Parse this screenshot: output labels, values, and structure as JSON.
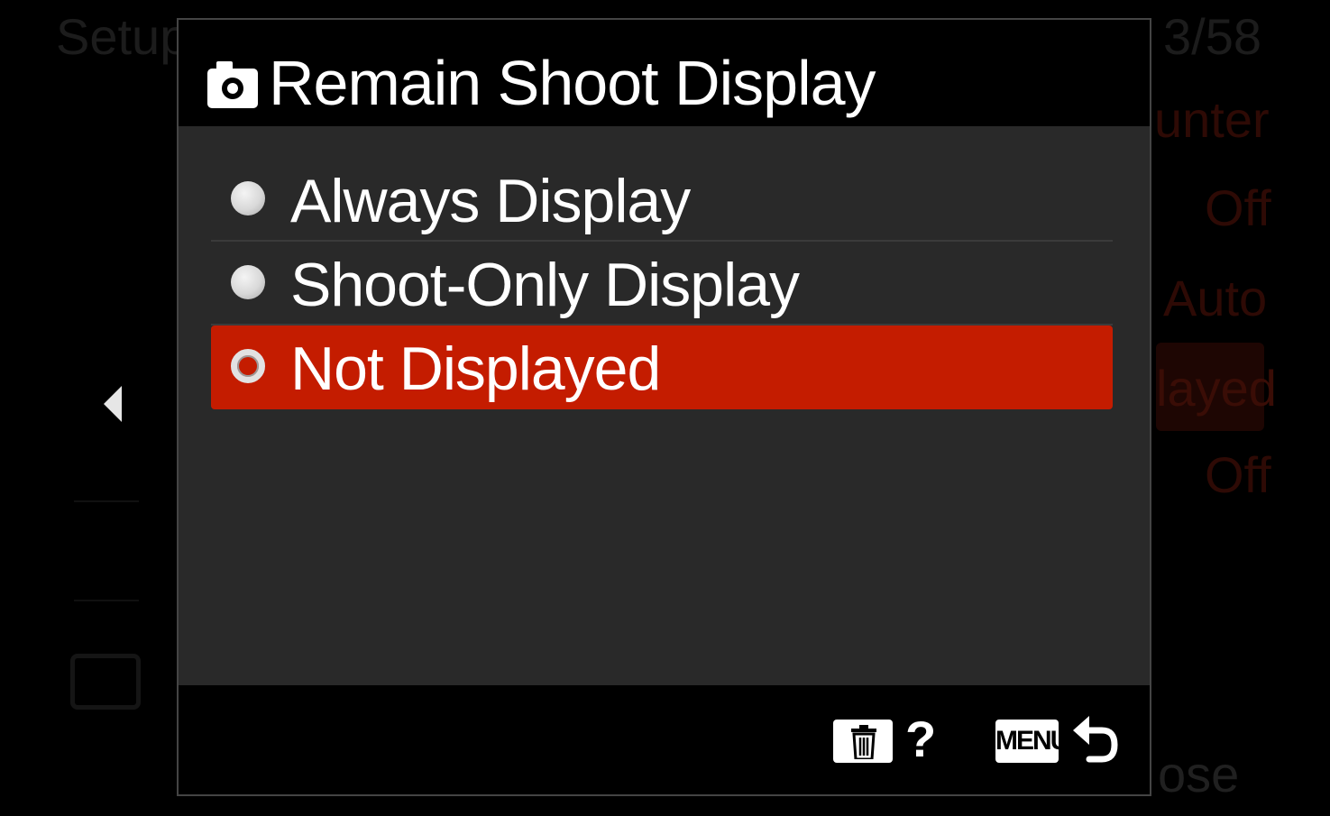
{
  "background": {
    "header_left": "Setup",
    "page_counter": "3/58",
    "values": [
      "unter",
      "Off",
      "Auto",
      "layed",
      "Off"
    ],
    "bottom_right": "ose"
  },
  "dialog": {
    "title": "Remain Shoot Display",
    "title_icon": "camera-icon",
    "options": [
      {
        "label": "Always Display",
        "selected": false
      },
      {
        "label": "Shoot-Only Display",
        "selected": false
      },
      {
        "label": "Not Displayed",
        "selected": true
      }
    ],
    "footer": {
      "delete_icon": "trash-icon",
      "help_label": "?",
      "menu_label": "MENU",
      "back_icon": "return-icon"
    }
  },
  "colors": {
    "selection": "#c41c00",
    "body_bg": "#292929",
    "text": "#ffffff"
  }
}
